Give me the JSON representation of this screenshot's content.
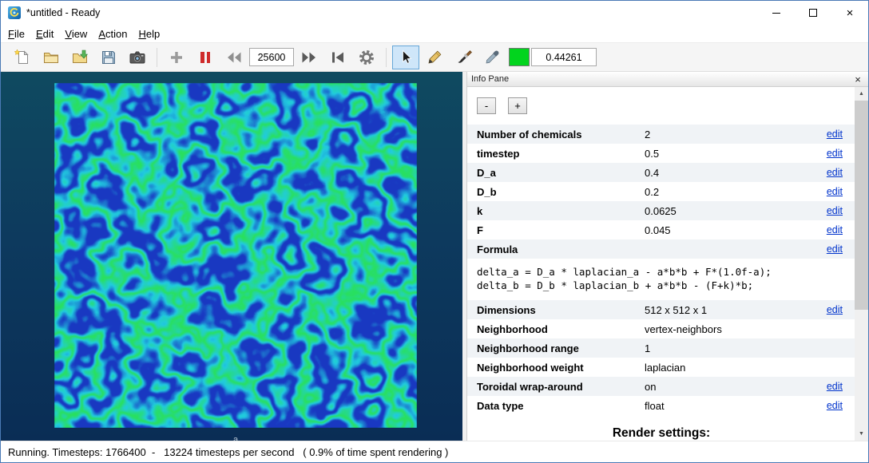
{
  "window": {
    "title": "*untitled - Ready",
    "close_glyph": "×"
  },
  "menu": {
    "items": [
      {
        "label": "File"
      },
      {
        "label": "Edit"
      },
      {
        "label": "View"
      },
      {
        "label": "Action"
      },
      {
        "label": "Help"
      }
    ]
  },
  "toolbar": {
    "timesteps_field": "25600",
    "value_field": "0.44261",
    "swatch_color": "#02d41e"
  },
  "icons": {
    "app-icon": "ready-logo-swirl",
    "new-file-icon": "page-with-star",
    "open-folder-icon": "folder",
    "folder-arrow-icon": "folder-with-green-arrow",
    "save-icon": "floppy-disk",
    "camera-icon": "camera",
    "plus-icon": "gray-plus",
    "pause-icon": "red-pause-bars",
    "rewind-icon": "double-left-triangles",
    "fast-forward-icon": "double-right-triangles",
    "skip-to-start-icon": "bar-left-triangle",
    "gear-icon": "cog",
    "cursor-icon": "pointer-arrow",
    "pencil-icon": "pencil",
    "brush-icon": "paintbrush",
    "eyedropper-icon": "pipette"
  },
  "canvas": {
    "chemical_label": "a",
    "palette": {
      "background": "#1f3ac2",
      "stripe_edge": "#21cfe0",
      "stripe_core": "#2ae05c"
    }
  },
  "info_pane": {
    "caption": "Info Pane",
    "close_glyph": "×",
    "decrease_label": "-",
    "increase_label": "+",
    "rows": [
      {
        "label": "Number of chemicals",
        "value": "2",
        "edit": "edit"
      },
      {
        "label": "timestep",
        "value": "0.5",
        "edit": "edit"
      },
      {
        "label": "D_a",
        "value": "0.4",
        "edit": "edit"
      },
      {
        "label": "D_b",
        "value": "0.2",
        "edit": "edit"
      },
      {
        "label": "k",
        "value": "0.0625",
        "edit": "edit"
      },
      {
        "label": "F",
        "value": "0.045",
        "edit": "edit"
      },
      {
        "label": "Formula",
        "value": "",
        "edit": "edit"
      },
      {
        "label": "Dimensions",
        "value": "512 x 512 x 1",
        "edit": "edit"
      },
      {
        "label": "Neighborhood",
        "value": "vertex-neighbors"
      },
      {
        "label": "Neighborhood range",
        "value": "1"
      },
      {
        "label": "Neighborhood weight",
        "value": "laplacian"
      },
      {
        "label": "Toroidal wrap-around",
        "value": "on",
        "edit": "edit"
      },
      {
        "label": "Data type",
        "value": "float",
        "edit": "edit"
      }
    ],
    "formula_lines": [
      "delta_a = D_a * laplacian_a - a*b*b + F*(1.0f-a);",
      "delta_b = D_b * laplacian_b + a*b*b - (F+k)*b;"
    ],
    "render_settings_heading": "Render settings:",
    "scrollbar": {
      "up": "▲",
      "down": "▼"
    }
  },
  "status": {
    "text": "Running. Timesteps: 1766400  -   13224 timesteps per second   ( 0.9% of time spent rendering )"
  }
}
